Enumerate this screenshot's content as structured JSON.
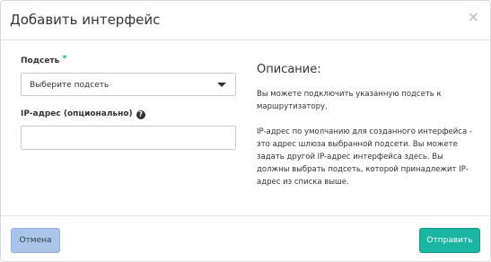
{
  "modal": {
    "title": "Добавить интерфейс",
    "close_glyph": "×"
  },
  "form": {
    "subnet": {
      "label": "Подсеть",
      "required_mark": "*",
      "selected_value": "Выберите подсеть"
    },
    "ip": {
      "label": "IP-адрес (опционально)",
      "help_glyph": "?",
      "value": ""
    }
  },
  "description": {
    "heading": "Описание:",
    "p1": "Вы можете подключить указанную подсеть к маршрутизатору.",
    "p2": "IP-адрес по умолчанию для созданного интерфейса - это адрес шлюза выбранной подсети. Вы можете задать другой IP-адрес интерфейса здесь. Вы должны выбрать подсеть, которой принадлежит IP-адрес из списка выше."
  },
  "footer": {
    "cancel_label": "Отмена",
    "submit_label": "Отправить"
  },
  "colors": {
    "accent": "#1ab5a3",
    "cancel_bg": "#a9c4e8",
    "required": "#1fb0a5"
  }
}
